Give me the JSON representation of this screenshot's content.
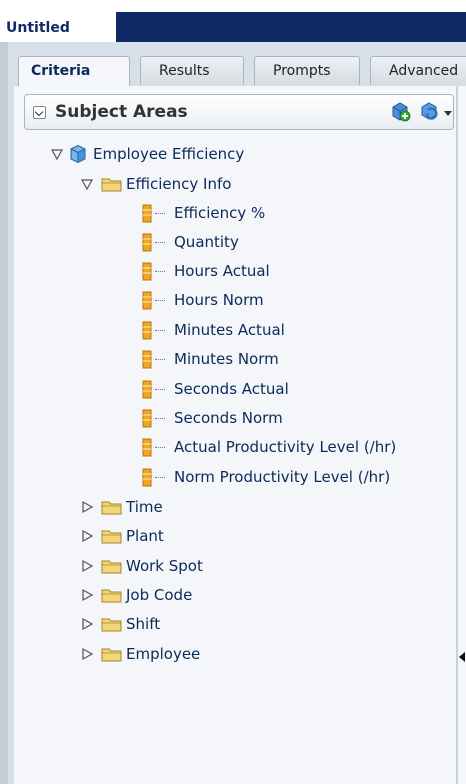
{
  "window": {
    "title": "Untitled"
  },
  "tabs": [
    {
      "label": "Criteria",
      "active": true
    },
    {
      "label": "Results",
      "active": false
    },
    {
      "label": "Prompts",
      "active": false
    },
    {
      "label": "Advanced",
      "active": false
    }
  ],
  "subject_areas": {
    "title": "Subject Areas",
    "icons": [
      "add-subject-area-icon",
      "refresh-icon",
      "dropdown-arrow-icon"
    ]
  },
  "tree": {
    "root": {
      "label": "Employee Efficiency",
      "expanded": true,
      "icon": "cube-icon"
    },
    "folders": [
      {
        "label": "Efficiency Info",
        "expanded": true,
        "columns": [
          "Efficiency %",
          "Quantity",
          "Hours Actual",
          "Hours Norm",
          "Minutes Actual",
          "Minutes Norm",
          "Seconds Actual",
          "Seconds Norm",
          "Actual Productivity Level (/hr)",
          "Norm Productivity Level (/hr)"
        ]
      },
      {
        "label": "Time",
        "expanded": false
      },
      {
        "label": "Plant",
        "expanded": false
      },
      {
        "label": "Work Spot",
        "expanded": false
      },
      {
        "label": "Job Code",
        "expanded": false
      },
      {
        "label": "Shift",
        "expanded": false
      },
      {
        "label": "Employee",
        "expanded": false
      }
    ]
  },
  "colors": {
    "navy": "#0f2a66",
    "tree_text": "#0b2a5a",
    "folder": "#e8c24a",
    "column_icon": "#f0a820"
  }
}
